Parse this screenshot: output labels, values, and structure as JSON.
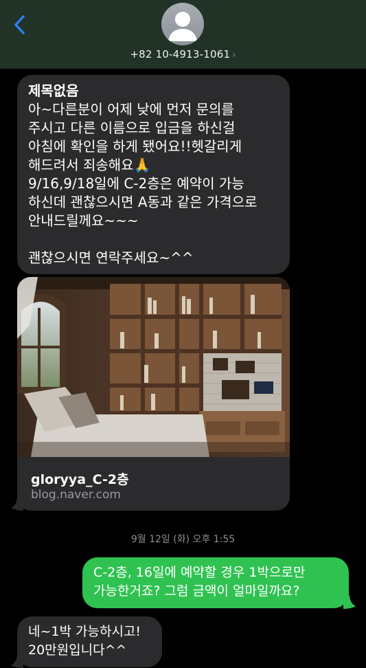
{
  "header": {
    "phone_number": "+82 10-4913-1061",
    "chevron": "›",
    "back_icon": "chevron-left-icon",
    "avatar_icon": "person-icon"
  },
  "messages": {
    "incoming_1": {
      "title": "제목없음",
      "lines": [
        "아~다른분이 어제 낮에 먼저 문의를",
        "주시고 다른 이름으로 입금을 하신걸",
        "아침에 확인을 하게 됐어요!!헷갈리게",
        "해드려서 죄송해요🙏",
        "9/16,9/18일에 C-2층은 예약이 가능",
        "하신데 괜찮으시면 A동과 같은 가격으로",
        "안내드릴께요~~~",
        "",
        "괜찮으시면 연락주세요~^^"
      ]
    },
    "link_preview": {
      "title": "gloryya_C-2층",
      "domain": "blog.naver.com"
    },
    "timestamp": "9월 12일 (화) 오후 1:55",
    "outgoing_1": {
      "lines": [
        "C-2층, 16일에 예약할 경우 1박으로만",
        "가능한거죠? 그럼 금액이 얼마일까요?"
      ]
    },
    "incoming_2": {
      "lines": [
        "네~1박 가능하시고!",
        "20만원입니다^^"
      ]
    }
  },
  "colors": {
    "header_bg": "#203326",
    "incoming_bubble": "#2b2b2d",
    "outgoing_bubble": "#30c251",
    "accent_blue": "#2f7cf6",
    "muted_text": "#8e8e93"
  }
}
